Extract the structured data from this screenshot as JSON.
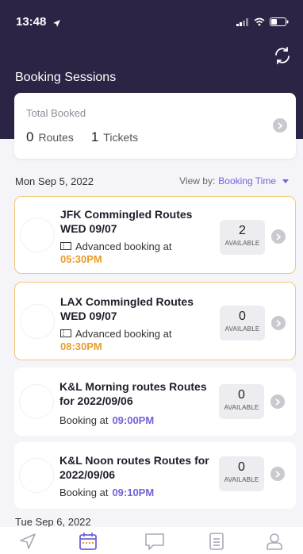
{
  "status": {
    "time": "13:48"
  },
  "header": {
    "title": "Booking Sessions"
  },
  "total": {
    "label": "Total Booked",
    "routes_count": "0",
    "routes_label": "Routes",
    "tickets_count": "1",
    "tickets_label": "Tickets"
  },
  "section1": {
    "date": "Mon Sep 5, 2022",
    "viewby_label": "View by:",
    "viewby_value": "Booking Time"
  },
  "sessions": [
    {
      "title": "JFK Commingled Routes WED 09/07",
      "sub": "Advanced booking at",
      "time": "05:30PM",
      "available": "2",
      "available_label": "AVAILABLE"
    },
    {
      "title": "LAX Commingled Routes WED 09/07",
      "sub": "Advanced booking at",
      "time": "08:30PM",
      "available": "0",
      "available_label": "AVAILABLE"
    },
    {
      "title": "K&L Morning routes Routes for 2022/09/06",
      "sub": "Booking at",
      "time": "09:00PM",
      "available": "0",
      "available_label": "AVAILABLE"
    },
    {
      "title": "K&L Noon routes Routes for 2022/09/06",
      "sub": "Booking at",
      "time": "09:10PM",
      "available": "0",
      "available_label": "AVAILABLE"
    }
  ],
  "section2": {
    "date": "Tue Sep 6, 2022"
  },
  "colors": {
    "header": "#2c2444",
    "accent": "#6f63d8",
    "orange": "#ec9c2a",
    "highlight_border": "#f0c877"
  },
  "tabs": [
    "navigation-icon",
    "calendar-icon",
    "chat-icon",
    "list-icon",
    "profile-icon"
  ]
}
